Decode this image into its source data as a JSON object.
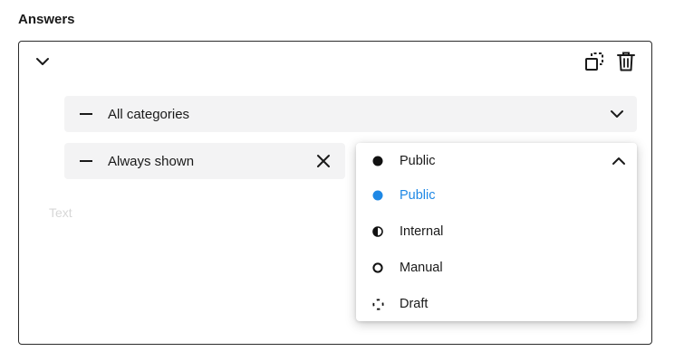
{
  "section": {
    "title": "Answers"
  },
  "card": {
    "collapse_icon": "chevron-down-icon",
    "toolbar": {
      "duplicate_icon": "duplicate-icon",
      "delete_icon": "trash-icon"
    },
    "category_field": {
      "icon": "minus-icon",
      "value": "All categories",
      "chevron_icon": "chevron-down-icon"
    },
    "visibility_field": {
      "icon": "minus-icon",
      "value": "Always shown",
      "clear_icon": "close-icon"
    },
    "text_placeholder": "Text"
  },
  "status_dropdown": {
    "selected_label": "Public",
    "expanded": true,
    "chevron_icon": "chevron-up-icon",
    "options": [
      {
        "label": "Public",
        "icon": "filled-circle-icon",
        "selected": true
      },
      {
        "label": "Internal",
        "icon": "half-circle-icon",
        "selected": false
      },
      {
        "label": "Manual",
        "icon": "ring-icon",
        "selected": false
      },
      {
        "label": "Draft",
        "icon": "dashed-circle-icon",
        "selected": false
      }
    ],
    "accent_color": "#1e88e5"
  }
}
